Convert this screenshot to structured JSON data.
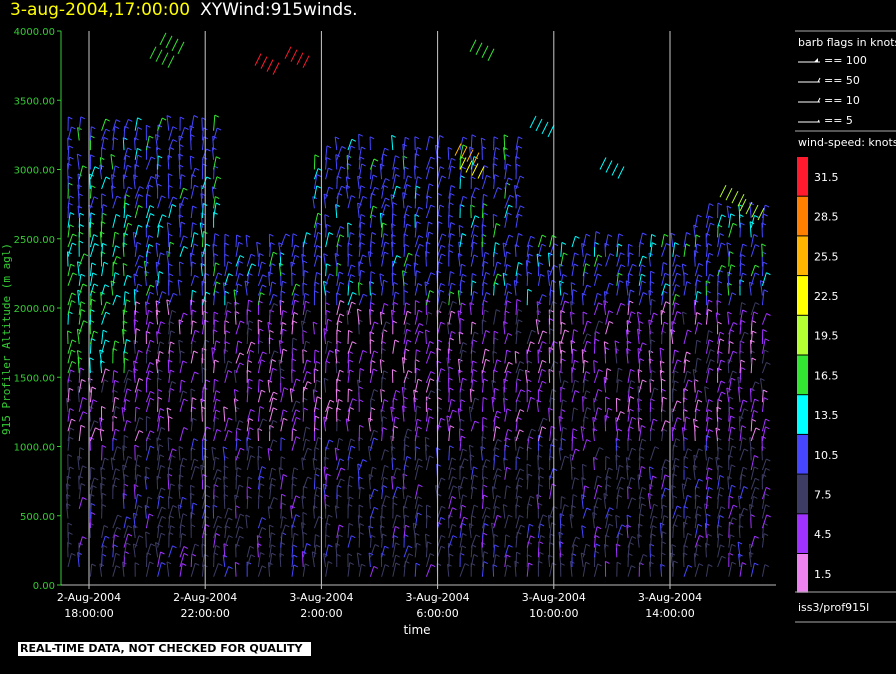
{
  "title": {
    "date": "3-aug-2004,17:00:00",
    "name": "XYWind:915winds."
  },
  "quality_note": "REAL-TIME DATA, NOT CHECKED FOR QUALITY",
  "source_label": "iss3/prof915l",
  "legend": {
    "barb_title": "barb flags in knots",
    "barb_entries": [
      "== 100",
      "== 50",
      "== 10",
      "== 5"
    ],
    "speed_title": "wind-speed: knots",
    "speed_bins": [
      {
        "label": "31.5",
        "color": "#ff1a2e"
      },
      {
        "label": "28.5",
        "color": "#ff8000"
      },
      {
        "label": "25.5",
        "color": "#ffb400"
      },
      {
        "label": "22.5",
        "color": "#ffff00"
      },
      {
        "label": "19.5",
        "color": "#b4ff32"
      },
      {
        "label": "16.5",
        "color": "#32e632"
      },
      {
        "label": "13.5",
        "color": "#00ffff"
      },
      {
        "label": "10.5",
        "color": "#4646ff"
      },
      {
        "label": "7.5",
        "color": "#3c3c64"
      },
      {
        "label": "4.5",
        "color": "#a032ff"
      },
      {
        "label": "1.5",
        "color": "#ee82ee"
      }
    ]
  },
  "chart_data": {
    "type": "scatter",
    "ylabel": "915 Profiler Altitude (m agl)",
    "xlabel": "time",
    "ylim": [
      0,
      4000
    ],
    "y_ticks": [
      "0.00",
      "500.00",
      "1000.00",
      "1500.00",
      "2000.00",
      "2500.00",
      "3000.00",
      "3500.00",
      "4000.00"
    ],
    "x_ticks": [
      {
        "date": "2-Aug-2004",
        "time": "18:00:00"
      },
      {
        "date": "2-Aug-2004",
        "time": "22:00:00"
      },
      {
        "date": "3-Aug-2004",
        "time": "2:00:00"
      },
      {
        "date": "3-Aug-2004",
        "time": "6:00:00"
      },
      {
        "date": "3-Aug-2004",
        "time": "10:00:00"
      },
      {
        "date": "3-Aug-2004",
        "time": "14:00:00"
      }
    ],
    "grid": "vertical lines at time ticks",
    "content": "wind barbs colored by speed at each profile time and altitude"
  }
}
